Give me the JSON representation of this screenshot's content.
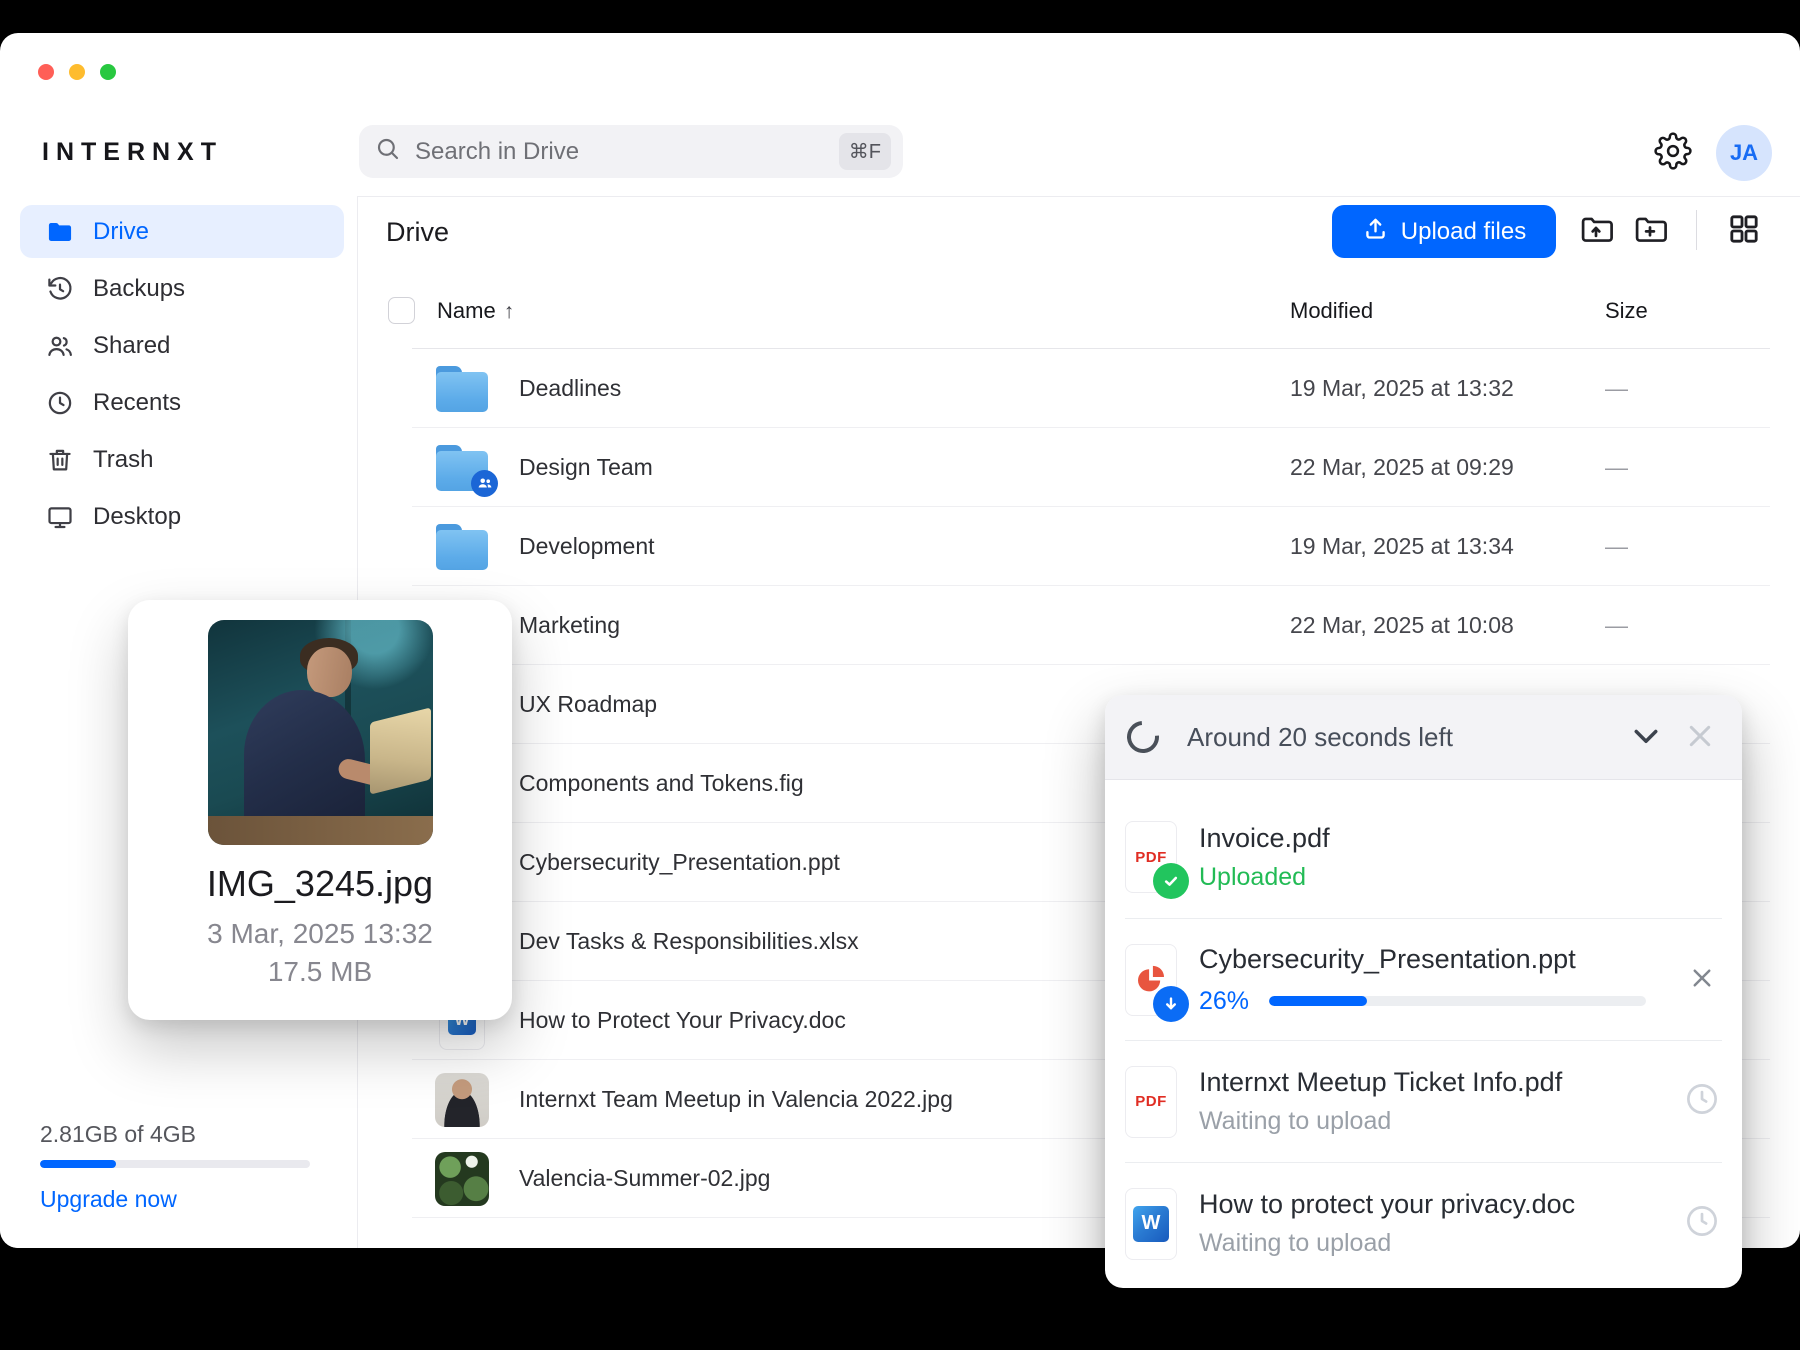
{
  "window": {
    "brand": "INTERNXT"
  },
  "topbar": {
    "search_placeholder": "Search in Drive",
    "search_shortcut": "⌘F",
    "avatar_initials": "JA"
  },
  "sidebar": {
    "items": [
      {
        "label": "Drive",
        "icon": "drive-folder-icon",
        "active": true
      },
      {
        "label": "Backups",
        "icon": "backups-history-icon",
        "active": false
      },
      {
        "label": "Shared",
        "icon": "shared-people-icon",
        "active": false
      },
      {
        "label": "Recents",
        "icon": "recents-clock-icon",
        "active": false
      },
      {
        "label": "Trash",
        "icon": "trash-icon",
        "active": false
      },
      {
        "label": "Desktop",
        "icon": "desktop-monitor-icon",
        "active": false
      }
    ],
    "storage": {
      "usage": "2.81GB of 4GB",
      "bar_percent": 28,
      "upgrade_label": "Upgrade now"
    }
  },
  "toolbar": {
    "title": "Drive",
    "upload_label": "Upload files"
  },
  "table": {
    "columns": {
      "name": "Name",
      "modified": "Modified",
      "size": "Size"
    },
    "sort_arrow": "↑",
    "rows": [
      {
        "name": "Deadlines",
        "modified": "19 Mar, 2025 at 13:32",
        "size": "—",
        "icon": "folder"
      },
      {
        "name": "Design Team",
        "modified": "22 Mar, 2025 at 09:29",
        "size": "—",
        "icon": "folder-shared"
      },
      {
        "name": "Development",
        "modified": "19 Mar, 2025 at 13:34",
        "size": "—",
        "icon": "folder"
      },
      {
        "name": "Marketing",
        "modified": "22 Mar, 2025 at 10:08",
        "size": "—",
        "icon": "folder"
      },
      {
        "name": "UX Roadmap",
        "modified": "",
        "size": "",
        "icon": "hidden"
      },
      {
        "name": "Components and Tokens.fig",
        "modified": "",
        "size": "",
        "icon": "hidden"
      },
      {
        "name": "Cybersecurity_Presentation.ppt",
        "modified": "",
        "size": "",
        "icon": "hidden"
      },
      {
        "name": "Dev Tasks & Responsibilities.xlsx",
        "modified": "",
        "size": "",
        "icon": "hidden"
      },
      {
        "name": "How to Protect Your Privacy.doc",
        "modified": "",
        "size": "",
        "icon": "doc"
      },
      {
        "name": "Internxt Team Meetup in Valencia 2022.jpg",
        "modified": "",
        "size": "",
        "icon": "photo-person"
      },
      {
        "name": "Valencia-Summer-02.jpg",
        "modified": "",
        "size": "",
        "icon": "photo-leaves"
      }
    ]
  },
  "preview_card": {
    "filename": "IMG_3245.jpg",
    "date": "3 Mar, 2025 13:32",
    "size": "17.5 MB"
  },
  "upload_panel": {
    "title": "Around 20 seconds left",
    "items": [
      {
        "name": "Invoice.pdf",
        "status": "Uploaded",
        "state": "uploaded",
        "icon": "pdf",
        "progress_percent": 100
      },
      {
        "name": "Cybersecurity_Presentation.ppt",
        "status": "26%",
        "state": "uploading",
        "icon": "ppt",
        "progress_percent": 26
      },
      {
        "name": "Internxt Meetup Ticket Info.pdf",
        "status": "Waiting to upload",
        "state": "waiting",
        "icon": "pdf"
      },
      {
        "name": "How to protect your privacy.doc",
        "status": "Waiting to upload",
        "state": "waiting",
        "icon": "doc"
      }
    ]
  },
  "colors": {
    "accent_blue": "#0066ff",
    "success_green": "#22c55e",
    "pdf_red": "#e02d23",
    "ppt_orange": "#e8553f",
    "word_blue": "#185abd"
  }
}
